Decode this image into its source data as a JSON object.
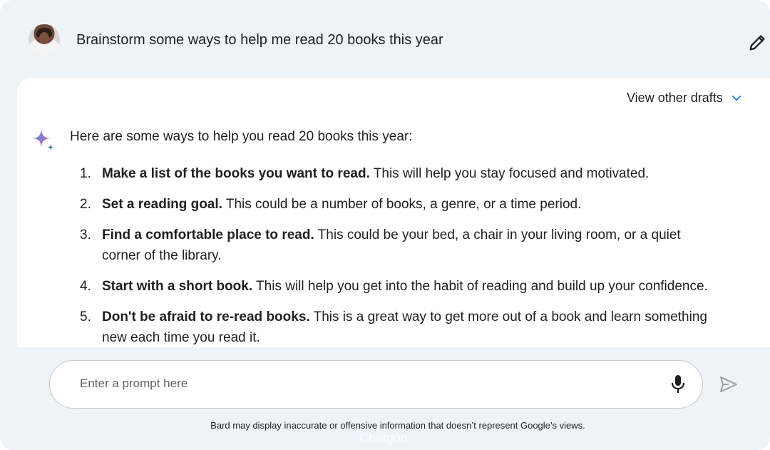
{
  "user": {
    "prompt": "Brainstorm some ways to help me read 20 books this year"
  },
  "response": {
    "drafts_label": "View other drafts",
    "intro": "Here are some ways to help you read 20 books this year:",
    "items": [
      {
        "num": "1.",
        "bold": "Make a list of the books you want to read.",
        "text": " This will help you stay focused and motivated."
      },
      {
        "num": "2.",
        "bold": "Set a reading goal.",
        "text": " This could be a number of books, a genre, or a time period."
      },
      {
        "num": "3.",
        "bold": "Find a comfortable place to read.",
        "text": " This could be your bed, a chair in your living room, or a quiet corner of the library."
      },
      {
        "num": "4.",
        "bold": "Start with a short book.",
        "text": " This will help you get into the habit of reading and build up your confidence."
      },
      {
        "num": "5.",
        "bold": "Don't be afraid to re-read books.",
        "text": " This is a great way to get more out of a book and learn something new each time you read it."
      }
    ]
  },
  "composer": {
    "placeholder": "Enter a prompt here"
  },
  "footer": {
    "disclaimer": "Bard may display inaccurate or offensive information that doesn’t represent Google’s views.",
    "watermark": "Chatgoo"
  },
  "icons": {
    "edit": "pencil-icon",
    "drafts": "chevron-down-icon",
    "assistant": "sparkle-icon",
    "mic": "microphone-icon",
    "send": "send-icon"
  },
  "colors": {
    "background": "#eef2f9",
    "card": "#ffffff",
    "accent": "#1a73e8",
    "text": "#1f1f1f"
  }
}
